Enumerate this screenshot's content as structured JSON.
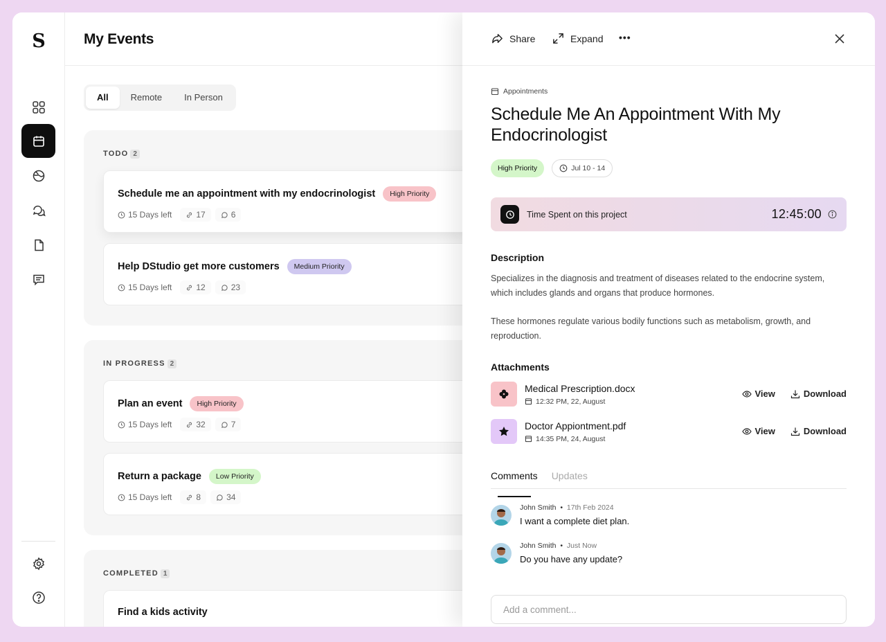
{
  "app": {
    "logo": "S"
  },
  "sidebar": {
    "items": [
      {
        "name": "dashboard",
        "icon": "grid-icon"
      },
      {
        "name": "calendar",
        "icon": "calendar-icon",
        "active": true
      },
      {
        "name": "globe",
        "icon": "globe-icon"
      },
      {
        "name": "chat",
        "icon": "chat-icon"
      },
      {
        "name": "documents",
        "icon": "document-icon"
      },
      {
        "name": "messages",
        "icon": "message-icon"
      }
    ],
    "bottom": [
      {
        "name": "settings",
        "icon": "gear-icon"
      },
      {
        "name": "help",
        "icon": "help-icon"
      }
    ]
  },
  "main": {
    "title": "My Events",
    "filters": [
      {
        "label": "All",
        "active": true
      },
      {
        "label": "Remote"
      },
      {
        "label": "In Person"
      }
    ],
    "groups": [
      {
        "title": "TODO",
        "count": "2",
        "cards": [
          {
            "title": "Schedule me an appointment with my endocrinologist",
            "priority": "High Priority",
            "days": "15 Days left",
            "links": "17",
            "comments": "6"
          },
          {
            "title": "Help DStudio get more customers",
            "priority": "Medium Priority",
            "days": "15 Days left",
            "links": "12",
            "comments": "23"
          }
        ]
      },
      {
        "title": "IN PROGRESS",
        "count": "2",
        "cards": [
          {
            "title": "Plan an event",
            "priority": "High Priority",
            "days": "15 Days left",
            "links": "32",
            "comments": "7"
          },
          {
            "title": "Return a package",
            "priority": "Low Priority",
            "days": "15 Days left",
            "links": "8",
            "comments": "34"
          }
        ]
      },
      {
        "title": "COMPLETED",
        "count": "1",
        "cards": [
          {
            "title": "Find a kids activity"
          }
        ]
      }
    ]
  },
  "panel": {
    "share": "Share",
    "expand": "Expand",
    "more": "•••",
    "breadcrumb": "Appointments",
    "title": "Schedule Me An Appointment With My Endocrinologist",
    "priority": "High Priority",
    "date": "Jul 10 - 14",
    "timer": {
      "label": "Time Spent on this project",
      "value": "12:45:00"
    },
    "description_label": "Description",
    "description_p1": "Specializes in the diagnosis and treatment of diseases related to the endocrine system, which includes glands and organs that produce hormones.",
    "description_p2": "These hormones regulate various bodily functions such as metabolism, growth, and reproduction.",
    "attachments_label": "Attachments",
    "attachments": [
      {
        "name": "Medical Prescription.docx",
        "date": "12:32 PM, 22, August",
        "icon": "flower-icon",
        "color": "#f8c3c8"
      },
      {
        "name": "Doctor Appiontment.pdf",
        "date": "14:35 PM, 24, August",
        "icon": "star-icon",
        "color": "#e3c8f8"
      }
    ],
    "view_label": "View",
    "download_label": "Download",
    "tabs": [
      {
        "label": "Comments",
        "active": true
      },
      {
        "label": "Updates"
      }
    ],
    "comments": [
      {
        "author": "John Smith",
        "when": "17th Feb 2024",
        "text": "I want a complete diet plan."
      },
      {
        "author": "John Smith",
        "when": "Just Now",
        "text": "Do you have any update?"
      }
    ],
    "comment_placeholder": "Add a comment..."
  },
  "colors": {
    "background": "#eed7f2",
    "high": "#f8c3c8",
    "medium": "#cfc8f0",
    "low": "#d4f6c9",
    "active_nav": "#0e0e0e"
  }
}
